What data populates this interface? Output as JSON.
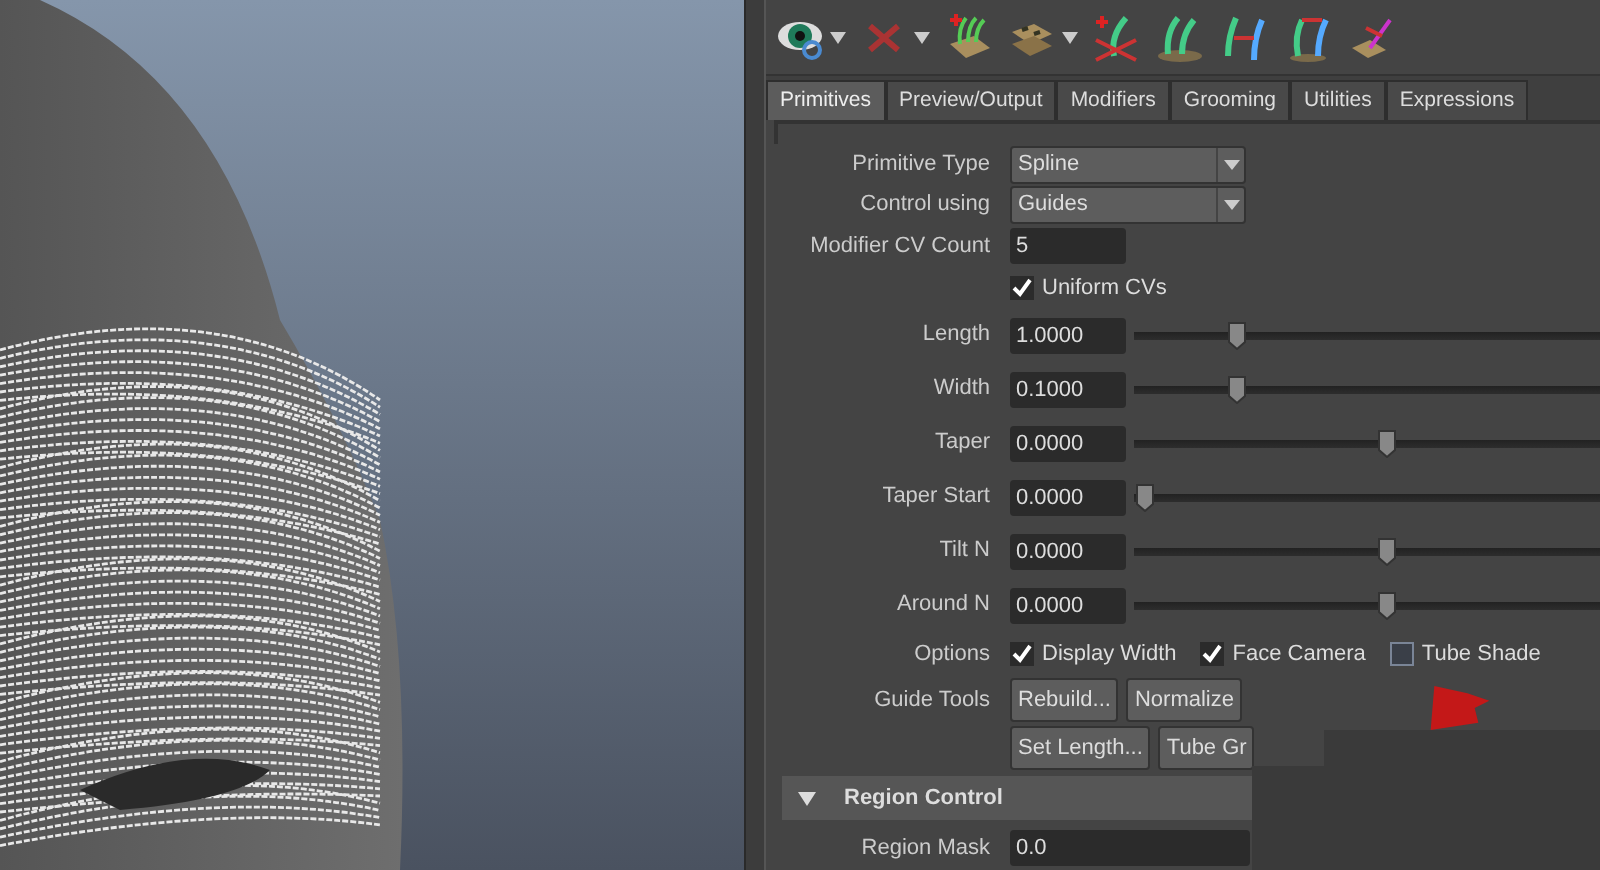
{
  "toolbar": {
    "items": [
      {
        "kind": "eye",
        "menu": true
      },
      {
        "kind": "cross",
        "menu": true
      },
      {
        "kind": "hair-add",
        "menu": false
      },
      {
        "kind": "tiles",
        "menu": true
      },
      {
        "kind": "guide-add",
        "menu": false
      },
      {
        "kind": "guides",
        "menu": false
      },
      {
        "kind": "guides-link",
        "menu": false
      },
      {
        "kind": "guides-move",
        "menu": false
      },
      {
        "kind": "guide-tile",
        "menu": false
      }
    ]
  },
  "tabs": [
    {
      "label": "Primitives",
      "selected": true
    },
    {
      "label": "Preview/Output",
      "selected": false
    },
    {
      "label": "Modifiers",
      "selected": false
    },
    {
      "label": "Grooming",
      "selected": false
    },
    {
      "label": "Utilities",
      "selected": false
    },
    {
      "label": "Expressions",
      "selected": false
    }
  ],
  "attributes": [
    {
      "kind": "dropdown",
      "label": "Primitive Type",
      "value": "Spline"
    },
    {
      "kind": "dropdown",
      "label": "Control using",
      "value": "Guides"
    },
    {
      "kind": "field",
      "label": "Modifier CV Count",
      "value": "5"
    },
    {
      "kind": "checkbox",
      "label": "Uniform CVs",
      "checked": true
    },
    {
      "kind": "slider",
      "label": "Length",
      "value": "1.0000",
      "level": 0.22
    },
    {
      "kind": "slider",
      "label": "Width",
      "value": "0.1000",
      "level": 0.22
    },
    {
      "kind": "slider",
      "label": "Taper",
      "value": "0.0000",
      "level": 0.54
    },
    {
      "kind": "slider",
      "label": "Taper Start",
      "value": "0.0000",
      "level": 0.02
    },
    {
      "kind": "slider",
      "label": "Tilt N",
      "value": "0.0000",
      "level": 0.54
    },
    {
      "kind": "slider",
      "label": "Around N",
      "value": "0.0000",
      "level": 0.54
    },
    {
      "kind": "options",
      "label": "Options",
      "options": [
        {
          "label": "Display Width",
          "checked": true
        },
        {
          "label": "Face Camera",
          "checked": true
        },
        {
          "label": "Tube Shade",
          "checked": false
        }
      ]
    },
    {
      "kind": "buttons",
      "label": "Guide Tools",
      "buttons": [
        "Rebuild...",
        "Normalize"
      ]
    },
    {
      "kind": "buttons",
      "buttons": [
        "Set Length...",
        "Tube Gr"
      ]
    }
  ],
  "region_control": {
    "title": "Region Control",
    "expanded": true,
    "fields": [
      {
        "label": "Region Mask",
        "value": "0.0"
      }
    ]
  }
}
